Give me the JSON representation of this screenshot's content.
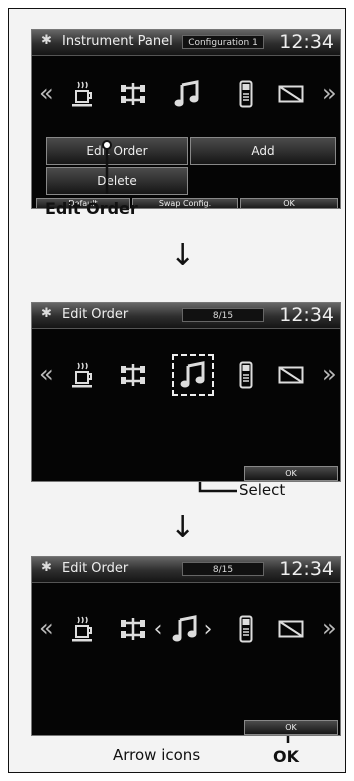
{
  "screen1": {
    "title": "Instrument Panel",
    "config_label": "Configuration 1",
    "clock": "12:34",
    "buttons": {
      "edit_order": "Edit Order",
      "add": "Add",
      "delete": "Delete",
      "default": "Default",
      "swap_config": "Swap Config.",
      "ok": "OK"
    }
  },
  "screen2": {
    "title": "Edit Order",
    "page_indicator": "8/15",
    "clock": "12:34",
    "ok": "OK"
  },
  "screen3": {
    "title": "Edit Order",
    "page_indicator": "8/15",
    "clock": "12:34",
    "ok": "OK"
  },
  "callouts": {
    "edit_order": "Edit Order",
    "select": "Select",
    "arrow_icons": "Arrow icons",
    "ok": "OK"
  },
  "icons": [
    "gear-icon",
    "chevron-left-icon",
    "coffee-cup-icon",
    "drivetrain-icon",
    "music-note-icon",
    "phone-icon",
    "blank-screen-icon",
    "chevron-right-icon"
  ]
}
